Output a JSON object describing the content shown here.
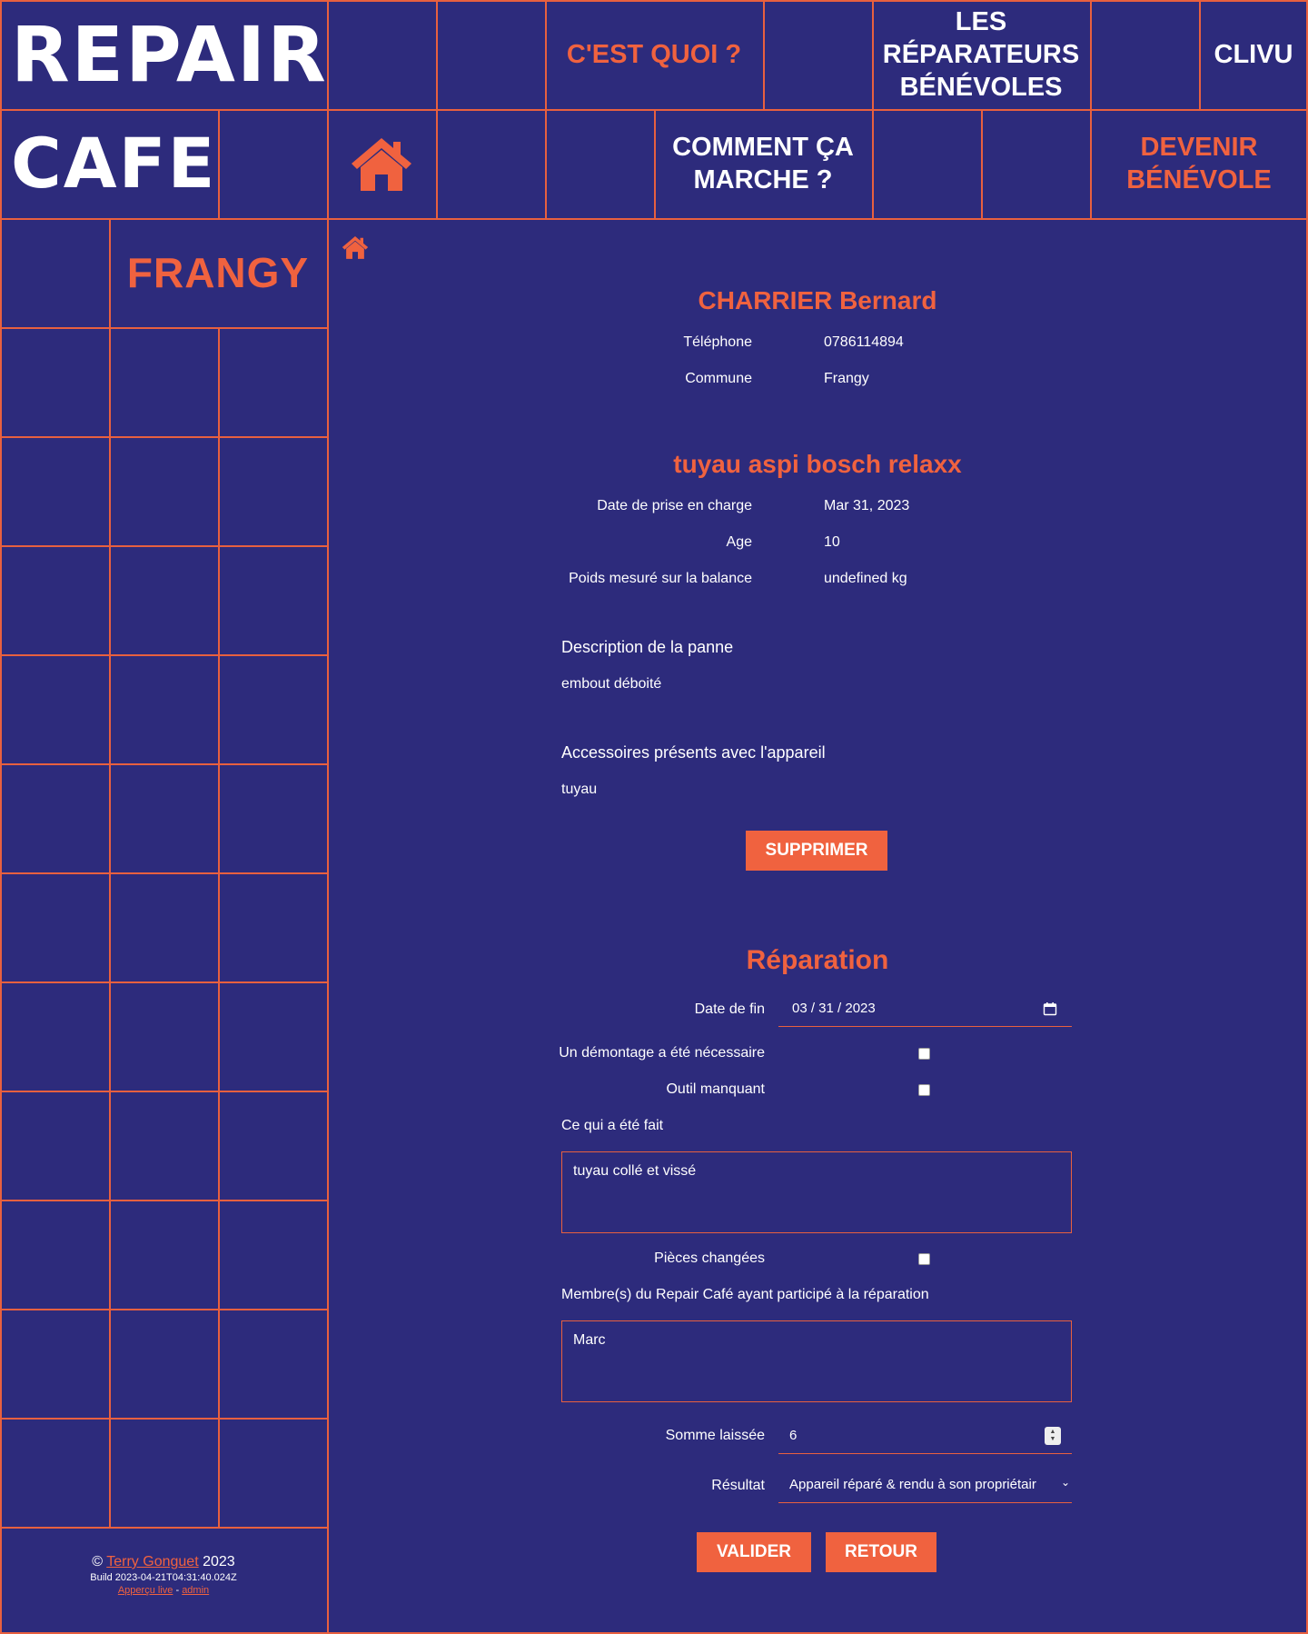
{
  "header": {
    "logo_line1": "REPAIR",
    "logo_line2": "CAFE",
    "nav": {
      "cest_quoi": "C'EST QUOI ?",
      "reparateurs_line1": "LES",
      "reparateurs_line2": "RÉPARATEURS",
      "reparateurs_line3": "BÉNÉVOLES",
      "clivu": "CLIVU",
      "comment_line1": "COMMENT ÇA",
      "comment_line2": "MARCHE ?",
      "devenir_line1": "DEVENIR",
      "devenir_line2": "BÉNÉVOLE"
    },
    "city": "FRANGY"
  },
  "client": {
    "name": "CHARRIER Bernard",
    "phone_label": "Téléphone",
    "phone": "0786114894",
    "commune_label": "Commune",
    "commune": "Frangy"
  },
  "item": {
    "title": "tuyau aspi bosch relaxx",
    "date_label": "Date de prise en charge",
    "date": "Mar 31, 2023",
    "age_label": "Age",
    "age": "10",
    "weight_label": "Poids mesuré sur la balance",
    "weight": "undefined kg",
    "panne_label": "Description de la panne",
    "panne": "embout déboité",
    "accessories_label": "Accessoires présents avec l'appareil",
    "accessories": "tuyau",
    "delete_button": "SUPPRIMER"
  },
  "repair": {
    "title": "Réparation",
    "date_fin_label": "Date de fin",
    "date_fin": "03 / 31 / 2023",
    "demontage_label": "Un démontage a été nécessaire",
    "outil_label": "Outil manquant",
    "fait_label": "Ce qui a été fait",
    "fait": "tuyau collé et vissé",
    "pieces_label": "Pièces changées",
    "membres_label": "Membre(s) du Repair Café ayant participé à la réparation",
    "membres": "Marc",
    "somme_label": "Somme laissée",
    "somme": "6",
    "resultat_label": "Résultat",
    "resultat": "Appareil réparé & rendu à son propriétair",
    "valider_button": "VALIDER",
    "retour_button": "RETOUR"
  },
  "footer": {
    "copyright": "©",
    "author": "Terry Gonguet",
    "year": "2023",
    "build": "Build 2023-04-21T04:31:40.024Z",
    "apercu": "Apperçu live",
    "separator": "-",
    "admin": "admin"
  },
  "colors": {
    "background": "#2d2b7c",
    "accent": "#f0623f"
  }
}
